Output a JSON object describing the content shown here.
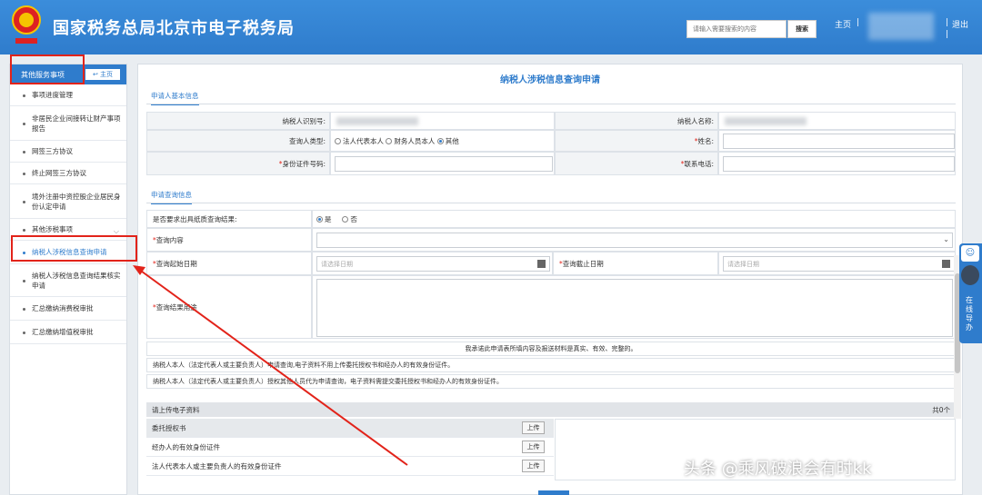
{
  "header": {
    "title": "国家税务总局北京市电子税务局",
    "search_placeholder": "请输入需要搜索的内容",
    "search_button": "搜索",
    "home": "主页",
    "separator": "|",
    "logout": "退出",
    "bg_color": "#2f7ccc"
  },
  "sidebar": {
    "title": "其他服务事项",
    "home_label": "主页",
    "items": [
      {
        "label": "事项进度管理"
      },
      {
        "label": "非居民企业间接转让财产事项报告"
      },
      {
        "label": "网签三方协议"
      },
      {
        "label": "终止网签三方协议"
      },
      {
        "label": "境外注册中资控股企业居民身份认定申请"
      },
      {
        "label": "其他涉税事项"
      },
      {
        "label": "纳税人涉税信息查询申请"
      },
      {
        "label": "纳税人涉税信息查询结果核实申请"
      },
      {
        "label": "汇总缴纳消费税审批"
      },
      {
        "label": "汇总缴纳增值税审批"
      }
    ]
  },
  "main": {
    "title": "纳税人涉税信息查询申请",
    "basic_section": "申请人基本信息",
    "basic": {
      "taxpayer_id_label": "纳税人识别号:",
      "taxpayer_name_label": "纳税人名称:",
      "query_type_label": "查询人类型:",
      "query_type_options": [
        "法人代表本人",
        "财务人员本人",
        "其他"
      ],
      "name_label": "姓名:",
      "id_number_label": "身份证件号码:",
      "phone_label": "联系电话:",
      "required_mark": "*"
    },
    "query_section": "申请查询信息",
    "query": {
      "paper_label": "是否要求出具纸质查询结果:",
      "paper_yes": "是",
      "paper_no": "否",
      "content_label": "查询内容",
      "start_label": "查询起始日期",
      "end_label": "查询截止日期",
      "date_placeholder": "请选择日期",
      "purpose_label": "查询结果用途"
    },
    "notices": [
      "我承诺此申请表所填内容及报送材料是真实、有效、完整的。",
      "纳税人本人（法定代表人或主要负责人）申请查询,电子资料不用上传委托授权书和经办人的有效身份证件。",
      "纳税人本人（法定代表人或主要负责人）授权其他人员代为申请查询，电子资料需提交委托授权书和经办人的有效身份证件。"
    ],
    "upload": {
      "title": "请上传电子资料",
      "count": "共0个",
      "button": "上传",
      "items": [
        "委托授权书",
        "经办人的有效身份证件",
        "法人代表本人或主要负责人的有效身份证件"
      ]
    }
  },
  "side_guide": {
    "text": "在线导办"
  },
  "watermark": "头条 @乘风破浪会有时kk",
  "annotation_color": "#e2231a"
}
